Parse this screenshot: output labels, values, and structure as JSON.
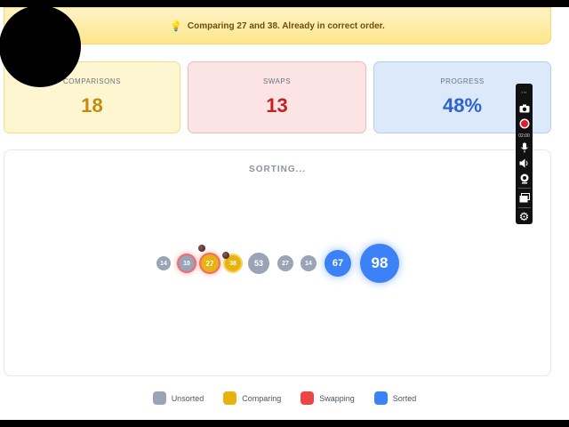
{
  "banner": {
    "message": "Comparing 27 and 38. Already in correct order.",
    "icon": "lightbulb-icon"
  },
  "stats": [
    {
      "label": "COMPARISONS",
      "value": "18"
    },
    {
      "label": "SWAPS",
      "value": "13"
    },
    {
      "label": "PROGRESS",
      "value": "48%"
    }
  ],
  "stage": {
    "title": "SORTING..."
  },
  "bubbles": [
    {
      "value": "14",
      "state": "unsorted"
    },
    {
      "value": "10",
      "state": "swapping"
    },
    {
      "value": "27",
      "state": "comparing-swap"
    },
    {
      "value": "38",
      "state": "comparing"
    },
    {
      "value": "53",
      "state": "unsorted"
    },
    {
      "value": "27",
      "state": "unsorted"
    },
    {
      "value": "14",
      "state": "unsorted"
    },
    {
      "value": "67",
      "state": "sorted"
    },
    {
      "value": "98",
      "state": "sorted"
    }
  ],
  "legend": [
    {
      "label": "Unsorted",
      "color": "#9aa4b6"
    },
    {
      "label": "Comparing",
      "color": "#e6b30f"
    },
    {
      "label": "Swapping",
      "color": "#ef4444"
    },
    {
      "label": "Sorted",
      "color": "#3b82f6"
    }
  ],
  "recorder": {
    "timer": "02:00"
  }
}
